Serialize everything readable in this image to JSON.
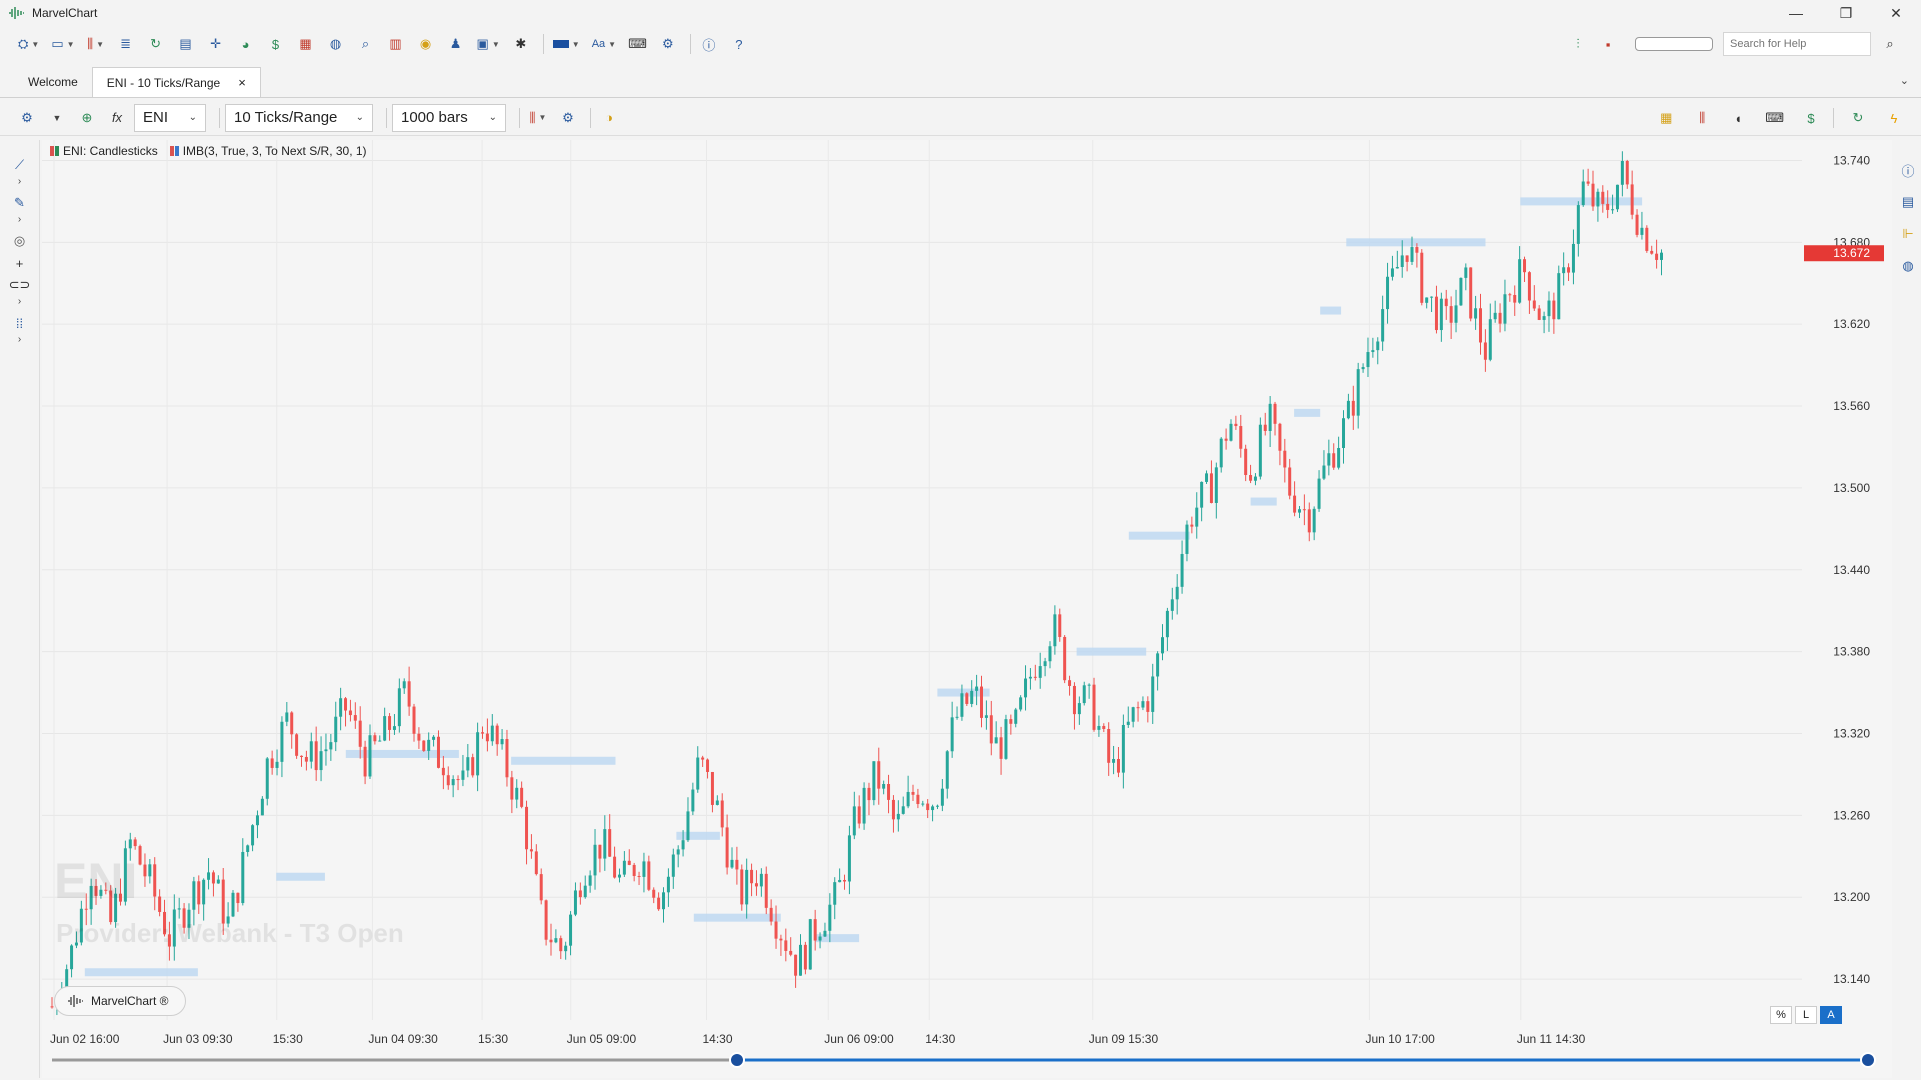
{
  "window": {
    "title": "MarvelChart",
    "minimize": "—",
    "maximize": "❐",
    "close": "✕"
  },
  "search": {
    "placeholder": "Search for Help"
  },
  "tabs": [
    {
      "label": "Welcome"
    },
    {
      "label": "ENI - 10 Ticks/Range",
      "close": "×"
    }
  ],
  "toolbar2": {
    "symbol": "ENI",
    "bar_type": "10 Ticks/Range",
    "bar_count": "1000 bars"
  },
  "legend": [
    {
      "label": "ENI: Candlesticks",
      "colors": [
        "#d9534f",
        "#2e8b57"
      ]
    },
    {
      "label": "IMB(3, True, 3, To Next S/R, 30, 1)",
      "colors": [
        "#d9534f",
        "#3a78c9"
      ]
    }
  ],
  "watermark": {
    "symbol": "ENI",
    "provider": "Provider: Webank - T3 Open"
  },
  "brand": {
    "label": "MarvelChart ®"
  },
  "scale_buttons": [
    "%",
    "L",
    "A"
  ],
  "colors": {
    "up": "#26a69a",
    "down": "#ef5350",
    "accent": "#1a6fc9",
    "price_tag": "#e53935",
    "zone": "#bcd7f1"
  },
  "chart_data": {
    "type": "candlestick",
    "symbol": "ENI",
    "y_ticks": [
      "13.740",
      "13.680",
      "13.620",
      "13.560",
      "13.500",
      "13.440",
      "13.380",
      "13.320",
      "13.260",
      "13.200",
      "13.140"
    ],
    "ylim": [
      13.11,
      13.755
    ],
    "last_price": "13.672",
    "x_labels": [
      "Jun 02 16:00",
      "Jun 03 09:30",
      "15:30",
      "Jun 04 09:30",
      "15:30",
      "Jun 05 09:00",
      "14:30",
      "Jun 06 09:00",
      "14:30",
      "Jun 09 15:30",
      "Jun 10 17:00",
      "Jun 11 14:30"
    ],
    "x_label_fractions": [
      0.0,
      0.065,
      0.128,
      0.183,
      0.246,
      0.297,
      0.375,
      0.445,
      0.503,
      0.597,
      0.756,
      0.843
    ],
    "path": [
      13.12,
      13.16,
      13.22,
      13.18,
      13.24,
      13.21,
      13.17,
      13.2,
      13.22,
      13.18,
      13.24,
      13.3,
      13.33,
      13.3,
      13.31,
      13.34,
      13.3,
      13.32,
      13.35,
      13.31,
      13.3,
      13.28,
      13.33,
      13.3,
      13.26,
      13.18,
      13.16,
      13.22,
      13.24,
      13.21,
      13.23,
      13.2,
      13.24,
      13.3,
      13.26,
      13.2,
      13.22,
      13.18,
      13.15,
      13.18,
      13.2,
      13.26,
      13.29,
      13.25,
      13.28,
      13.27,
      13.33,
      13.35,
      13.31,
      13.32,
      13.37,
      13.4,
      13.35,
      13.34,
      13.29,
      13.33,
      13.35,
      13.42,
      13.48,
      13.5,
      13.55,
      13.51,
      13.55,
      13.5,
      13.48,
      13.52,
      13.55,
      13.6,
      13.64,
      13.68,
      13.64,
      13.62,
      13.65,
      13.6,
      13.64,
      13.66,
      13.62,
      13.65,
      13.72,
      13.7,
      13.73,
      13.69,
      13.672
    ],
    "imbalance_zones": [
      {
        "price": 13.305,
        "start": 0.17,
        "end": 0.235
      },
      {
        "price": 13.3,
        "start": 0.265,
        "end": 0.325
      },
      {
        "price": 13.215,
        "start": 0.13,
        "end": 0.158
      },
      {
        "price": 13.185,
        "start": 0.37,
        "end": 0.42
      },
      {
        "price": 13.245,
        "start": 0.36,
        "end": 0.385
      },
      {
        "price": 13.17,
        "start": 0.44,
        "end": 0.465
      },
      {
        "price": 13.145,
        "start": 0.02,
        "end": 0.085
      },
      {
        "price": 13.38,
        "start": 0.59,
        "end": 0.63
      },
      {
        "price": 13.35,
        "start": 0.51,
        "end": 0.54
      },
      {
        "price": 13.465,
        "start": 0.62,
        "end": 0.655
      },
      {
        "price": 13.49,
        "start": 0.69,
        "end": 0.705
      },
      {
        "price": 13.68,
        "start": 0.745,
        "end": 0.825
      },
      {
        "price": 13.71,
        "start": 0.845,
        "end": 0.915
      },
      {
        "price": 13.63,
        "start": 0.73,
        "end": 0.742
      },
      {
        "price": 13.555,
        "start": 0.715,
        "end": 0.73
      }
    ]
  }
}
